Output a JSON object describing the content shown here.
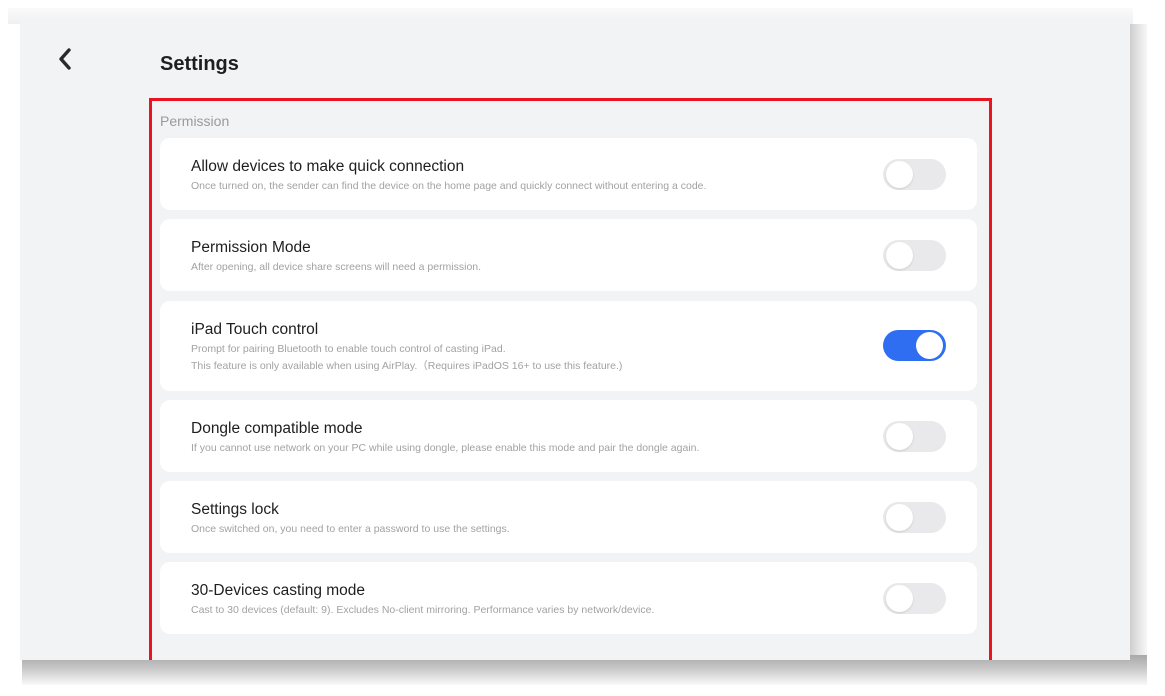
{
  "header": {
    "title": "Settings"
  },
  "section": {
    "label": "Permission"
  },
  "settings": [
    {
      "title": "Allow devices to make quick connection",
      "desc": [
        "Once turned on, the sender can find the device on the home page and quickly connect without entering a code."
      ],
      "enabled": false
    },
    {
      "title": "Permission Mode",
      "desc": [
        "After opening, all device share screens will need a permission."
      ],
      "enabled": false
    },
    {
      "title": "iPad Touch control",
      "desc": [
        "Prompt for pairing Bluetooth to enable touch control of casting iPad.",
        "This feature is only available when using AirPlay.（Requires iPadOS 16+ to use this feature.)"
      ],
      "enabled": true
    },
    {
      "title": "Dongle compatible mode",
      "desc": [
        "If you cannot use network on your PC while using dongle, please enable this mode and pair the dongle again."
      ],
      "enabled": false
    },
    {
      "title": "Settings lock",
      "desc": [
        "Once switched on, you need to enter a password to use the settings."
      ],
      "enabled": false
    },
    {
      "title": "30-Devices casting mode",
      "desc": [
        "Cast to 30 devices (default: 9). Excludes No-client mirroring. Performance varies by network/device."
      ],
      "enabled": false
    }
  ],
  "colors": {
    "toggle_on": "#2f6ef0",
    "toggle_off": "#e9e9eb",
    "highlight_border": "#e8141f",
    "background": "#f2f3f5"
  },
  "icons": {
    "back": "chevron-left-icon"
  }
}
